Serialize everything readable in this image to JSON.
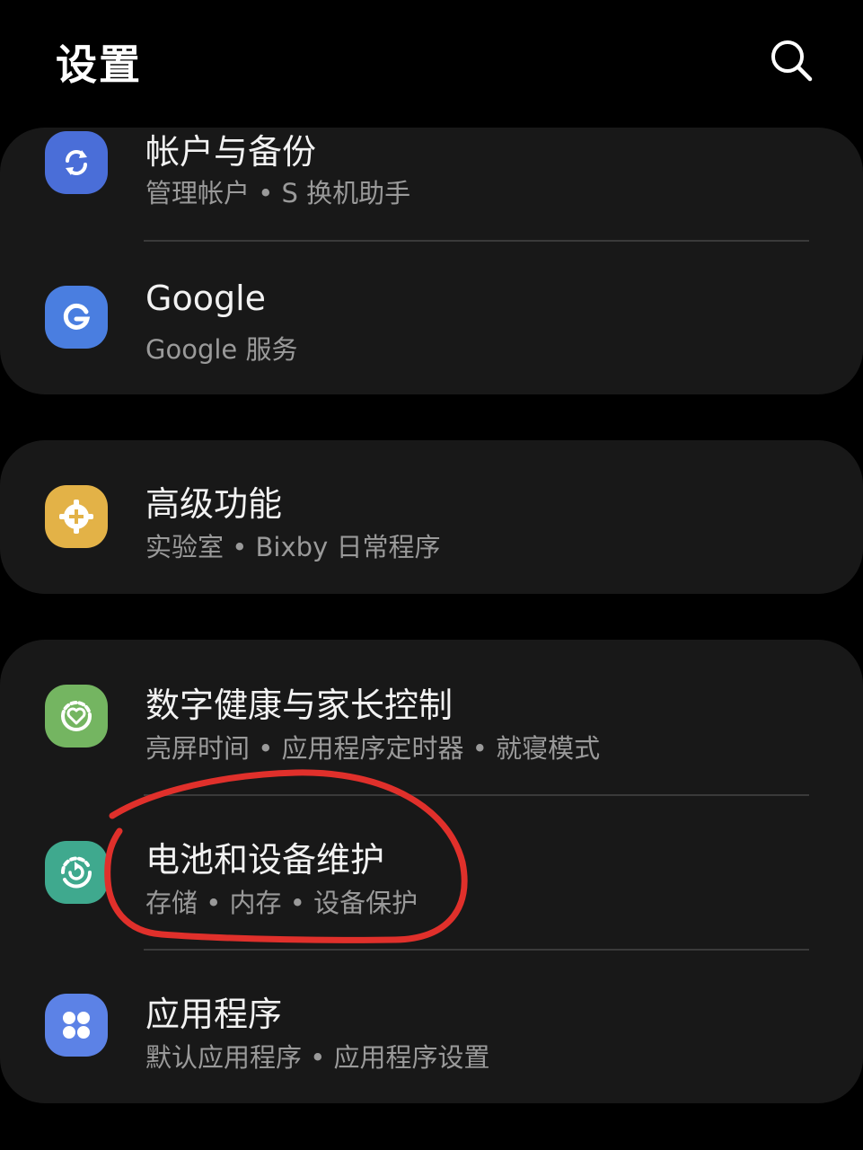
{
  "header": {
    "title": "设置",
    "search_icon": "search-icon"
  },
  "items": [
    {
      "title": "帐户与备份",
      "subtitle": "管理帐户 • S 换机助手",
      "icon": "sync-icon",
      "icon_color": "#4a6ed8"
    },
    {
      "title": "Google",
      "subtitle": "Google 服务",
      "icon": "google-icon",
      "icon_color": "#4a7ee0"
    },
    {
      "title": "高级功能",
      "subtitle": "实验室 • Bixby 日常程序",
      "icon": "gear-plus-icon",
      "icon_color": "#e3b247"
    },
    {
      "title": "数字健康与家长控制",
      "subtitle": "亮屏时间 • 应用程序定时器 • 就寝模式",
      "icon": "heart-circle-icon",
      "icon_color": "#74b561"
    },
    {
      "title": "电池和设备维护",
      "subtitle": "存储 • 内存 • 设备保护",
      "icon": "device-care-icon",
      "icon_color": "#3fa98e"
    },
    {
      "title": "应用程序",
      "subtitle": "默认应用程序 • 应用程序设置",
      "icon": "apps-grid-icon",
      "icon_color": "#5c82e6"
    }
  ],
  "annotation": {
    "type": "red-circle-mark",
    "color": "#e0302b",
    "target": "电池和设备维护"
  }
}
